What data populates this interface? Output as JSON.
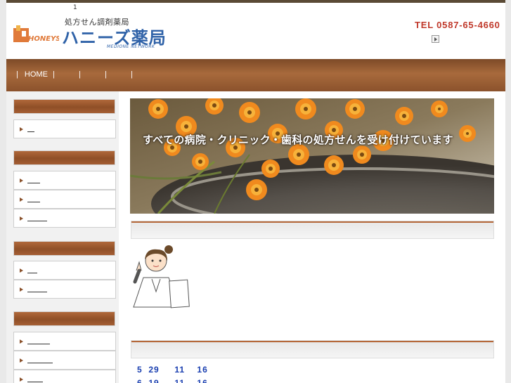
{
  "header": {
    "tiny_text": "1",
    "logo_subtitle": "処方せん調剤薬局",
    "logo_brand": "HONEYS",
    "logo_title": "ハニーズ薬局",
    "logo_network": "MEDIONE NETWORK",
    "tel": "TEL  0587-65-4660"
  },
  "nav": {
    "items": [
      "HOME",
      "",
      "",
      "",
      ""
    ]
  },
  "hero": {
    "caption": "すべての病院・クリニック・歯科の処方せんを受け付けています"
  },
  "news": [
    {
      "month": "5",
      "day": "29",
      "t1": "11",
      "t2": "16"
    },
    {
      "month": "6",
      "day": "19",
      "t1": "11",
      "t2": "16"
    }
  ],
  "colors": {
    "nav_brown": "#8b522c",
    "accent_red": "#c0392b",
    "logo_blue": "#2f62a8",
    "news_blue": "#1a3fb0"
  }
}
